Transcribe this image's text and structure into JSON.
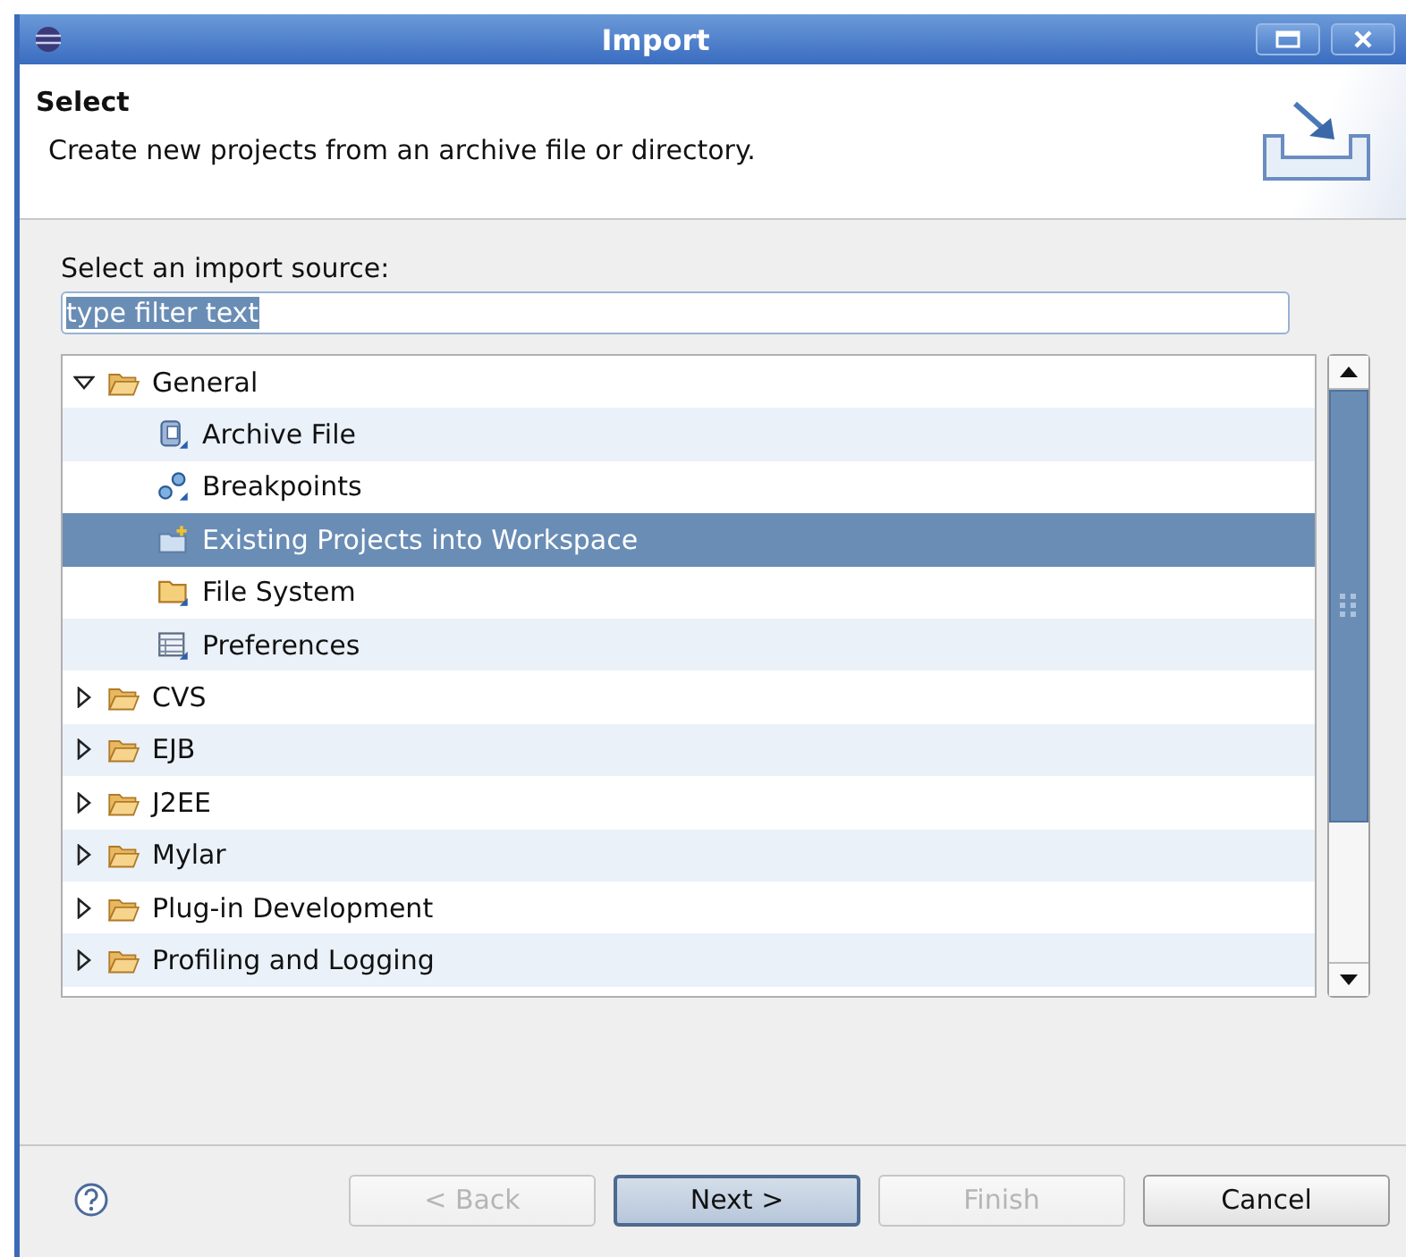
{
  "window": {
    "title": "Import"
  },
  "header": {
    "title": "Select",
    "description": "Create new projects from an archive file or directory."
  },
  "source_label": {
    "text": "Select an import source:"
  },
  "filter": {
    "value": "type filter text",
    "text_selected": true
  },
  "tree": [
    {
      "label": "General",
      "kind": "category",
      "expanded": true,
      "selected": false,
      "children": [
        {
          "label": "Archive File",
          "kind": "archive",
          "selected": false
        },
        {
          "label": "Breakpoints",
          "kind": "breakpoints",
          "selected": false
        },
        {
          "label": "Existing Projects into Workspace",
          "kind": "project",
          "selected": true
        },
        {
          "label": "File System",
          "kind": "folder",
          "selected": false
        },
        {
          "label": "Preferences",
          "kind": "preferences",
          "selected": false
        }
      ]
    },
    {
      "label": "CVS",
      "kind": "category",
      "expanded": false,
      "selected": false
    },
    {
      "label": "EJB",
      "kind": "category",
      "expanded": false,
      "selected": false
    },
    {
      "label": "J2EE",
      "kind": "category",
      "expanded": false,
      "selected": false
    },
    {
      "label": "Mylar",
      "kind": "category",
      "expanded": false,
      "selected": false
    },
    {
      "label": "Plug-in Development",
      "kind": "category",
      "expanded": false,
      "selected": false
    },
    {
      "label": "Profiling and Logging",
      "kind": "category",
      "expanded": false,
      "selected": false
    }
  ],
  "buttons": [
    {
      "label": "< Back",
      "disabled": true,
      "default": false
    },
    {
      "label": "Next >",
      "disabled": false,
      "default": true
    },
    {
      "label": "Finish",
      "disabled": true,
      "default": false
    },
    {
      "label": "Cancel",
      "disabled": false,
      "default": false
    }
  ]
}
